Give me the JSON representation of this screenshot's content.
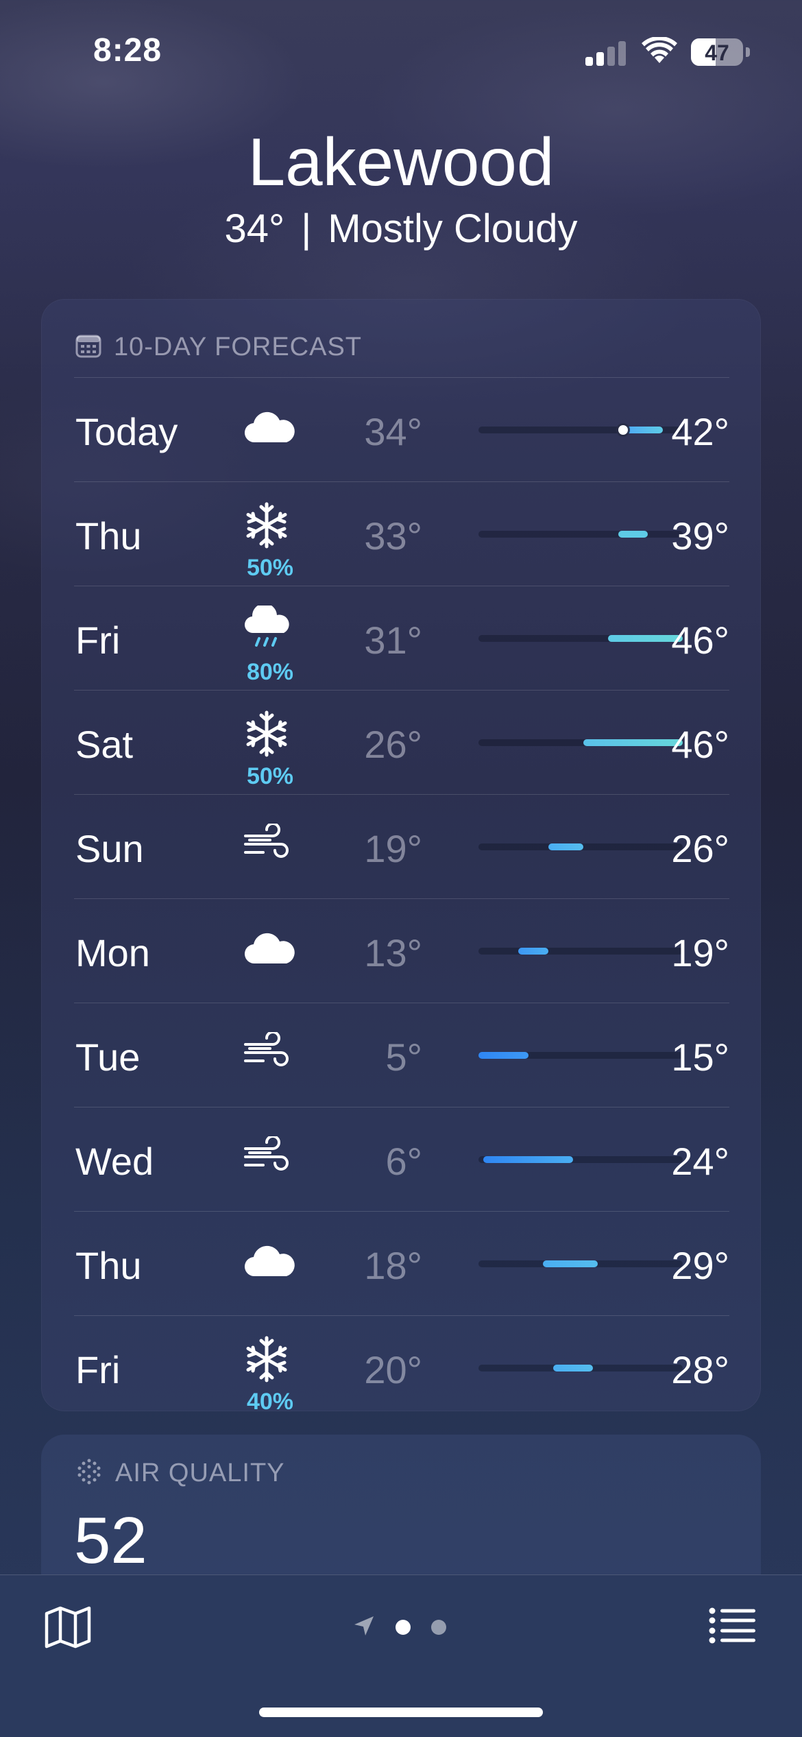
{
  "status_bar": {
    "time": "8:28",
    "battery": "47",
    "battery_level": 0.47
  },
  "header": {
    "city": "Lakewood",
    "temp": "34°",
    "separator": "|",
    "condition": "Mostly Cloudy"
  },
  "forecast": {
    "label": "10-DAY FORECAST",
    "range_min": 5,
    "range_max": 46,
    "days": [
      {
        "day": "Today",
        "icon": "cloud-icon",
        "precip": "",
        "lo": "34°",
        "hi": "42°",
        "lo_val": 34,
        "hi_val": 42,
        "bar_start": "#4ea8f5",
        "bar_end": "#5ecbe6",
        "current": 34
      },
      {
        "day": "Thu",
        "icon": "snowflake-icon",
        "precip": "50%",
        "lo": "33°",
        "hi": "39°",
        "lo_val": 33,
        "hi_val": 39,
        "bar_start": "#5ecbe6",
        "bar_end": "#5ecbe6"
      },
      {
        "day": "Fri",
        "icon": "cloud-rain-icon",
        "precip": "80%",
        "lo": "31°",
        "hi": "46°",
        "lo_val": 31,
        "hi_val": 46,
        "bar_start": "#5ecbe6",
        "bar_end": "#66d6da"
      },
      {
        "day": "Sat",
        "icon": "snowflake-icon",
        "precip": "50%",
        "lo": "26°",
        "hi": "46°",
        "lo_val": 26,
        "hi_val": 46,
        "bar_start": "#5ac1ea",
        "bar_end": "#66d6da"
      },
      {
        "day": "Sun",
        "icon": "wind-icon",
        "precip": "",
        "lo": "19°",
        "hi": "26°",
        "lo_val": 19,
        "hi_val": 26,
        "bar_start": "#4aaef2",
        "bar_end": "#55bdee"
      },
      {
        "day": "Mon",
        "icon": "cloud-icon",
        "precip": "",
        "lo": "13°",
        "hi": "19°",
        "lo_val": 13,
        "hi_val": 19,
        "bar_start": "#3d98f4",
        "bar_end": "#4aaef2"
      },
      {
        "day": "Tue",
        "icon": "wind-icon",
        "precip": "",
        "lo": "5°",
        "hi": "15°",
        "lo_val": 5,
        "hi_val": 15,
        "bar_start": "#2f86f3",
        "bar_end": "#3d98f4"
      },
      {
        "day": "Wed",
        "icon": "wind-icon",
        "precip": "",
        "lo": "6°",
        "hi": "24°",
        "lo_val": 6,
        "hi_val": 24,
        "bar_start": "#2f86f3",
        "bar_end": "#4aaef2"
      },
      {
        "day": "Thu",
        "icon": "cloud-icon",
        "precip": "",
        "lo": "18°",
        "hi": "29°",
        "lo_val": 18,
        "hi_val": 29,
        "bar_start": "#4aaef2",
        "bar_end": "#55bdee"
      },
      {
        "day": "Fri",
        "icon": "snowflake-icon",
        "precip": "40%",
        "lo": "20°",
        "hi": "28°",
        "lo_val": 20,
        "hi_val": 28,
        "bar_start": "#4aaef2",
        "bar_end": "#55bdee"
      }
    ]
  },
  "air_quality": {
    "label": "AIR QUALITY",
    "value": "52"
  },
  "tab_bar": {
    "map_icon": "map-icon",
    "location_icon": "location-arrow-icon",
    "list_icon": "list-icon",
    "pages": 2,
    "active_page": 0
  }
}
